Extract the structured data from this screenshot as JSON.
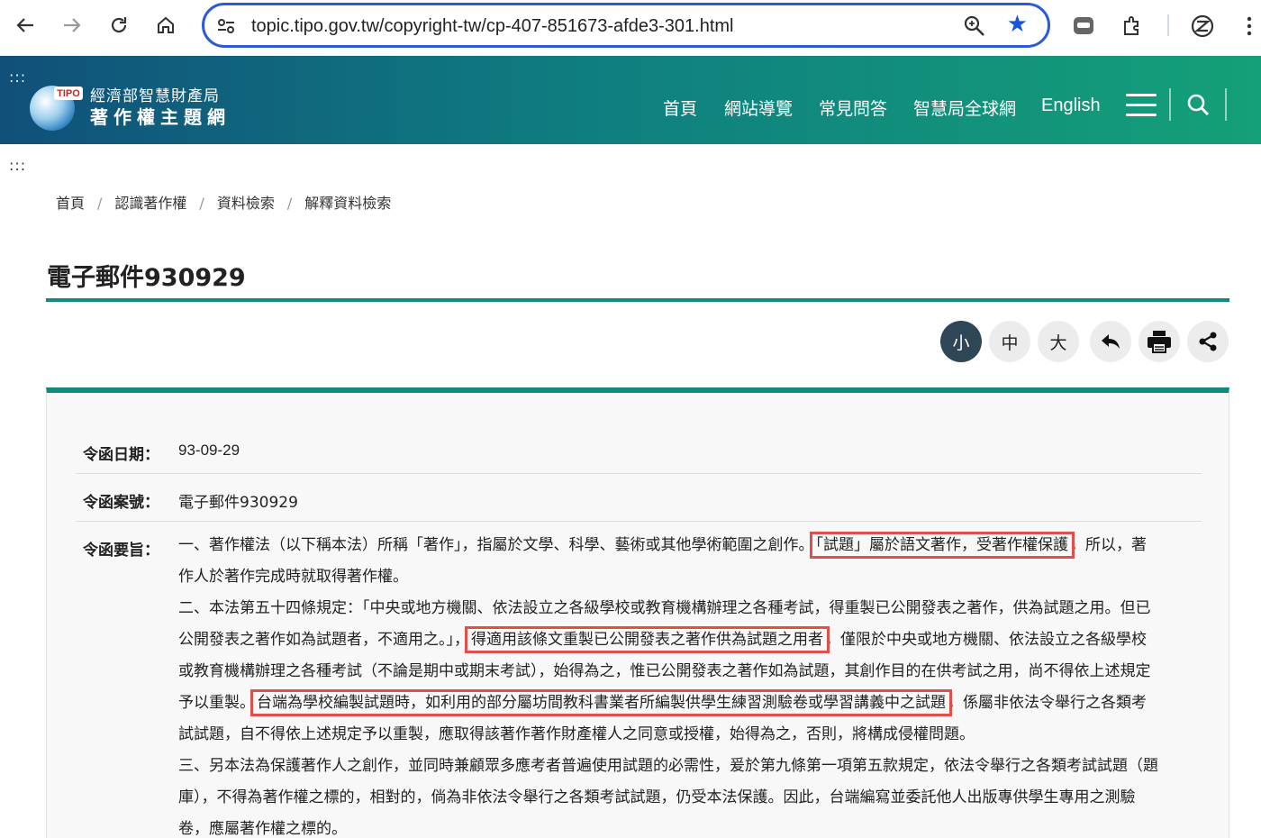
{
  "browser": {
    "url": "topic.tipo.gov.tw/copyright-tw/cp-407-851673-afde3-301.html"
  },
  "header": {
    "skip_marker": ":::",
    "logo_badge": "TIPO",
    "logo_line1": "經濟部智慧財產局",
    "logo_line2": "著作權主題網",
    "nav": [
      "首頁",
      "網站導覽",
      "常見問答",
      "智慧局全球網",
      "English"
    ]
  },
  "skip_marker_2": ":::",
  "breadcrumb": [
    "首頁",
    "認識著作權",
    "資料檢索",
    "解釋資料檢索"
  ],
  "breadcrumb_sep": "/",
  "page_title": "電子郵件930929",
  "tools": {
    "small": "小",
    "medium": "中",
    "large": "大"
  },
  "record": {
    "date_label": "令函日期：",
    "date_value": "93-09-29",
    "number_label": "令函案號：",
    "number_value": "電子郵件930929",
    "summary_label": "令函要旨：",
    "lines": [
      {
        "segments": [
          {
            "text": "一、著作權法（以下稱本法）所稱「著作」，指屬於文學、科學、藝術或其他學術範圍之創作。",
            "hl": false
          },
          {
            "text": "「試題」屬於語文著作，受著作權保護",
            "hl": true
          },
          {
            "text": "，所以，著",
            "hl": false
          }
        ]
      },
      {
        "segments": [
          {
            "text": "作人於著作完成時就取得著作權。",
            "hl": false
          }
        ]
      },
      {
        "segments": [
          {
            "text": "二、本法第五十四條規定：「中央或地方機關、依法設立之各級學校或教育機構辦理之各種考試，得重製已公開發表之著作，供為試題之用。但已",
            "hl": false
          }
        ]
      },
      {
        "segments": [
          {
            "text": "公開發表之著作如為試題者，不適用之。」，",
            "hl": false
          },
          {
            "text": "得適用該條文重製已公開發表之著作供為試題之用者",
            "hl": true
          },
          {
            "text": "，僅限於中央或地方機關、依法設立之各級學校",
            "hl": false
          }
        ]
      },
      {
        "segments": [
          {
            "text": "或教育機構辦理之各種考試（不論是期中或期末考試），始得為之，惟已公開發表之著作如為試題，其創作目的在供考試之用，尚不得依上述規定",
            "hl": false
          }
        ]
      },
      {
        "segments": [
          {
            "text": "予以重製。",
            "hl": false
          },
          {
            "text": "台端為學校編製試題時，如利用的部分屬坊間教科書業者所編製供學生練習測驗卷或學習講義中之試題",
            "hl": true
          },
          {
            "text": "，係屬非依法令舉行之各類考",
            "hl": false
          }
        ]
      },
      {
        "segments": [
          {
            "text": "試試題，自不得依上述規定予以重製，應取得該著作著作財產權人之同意或授權，始得為之，否則，將構成侵權問題。",
            "hl": false
          }
        ]
      },
      {
        "segments": [
          {
            "text": "三、另本法為保護著作人之創作，並同時兼顧眾多應考者普遍使用試題的必需性，爰於第九條第一項第五款規定，依法令舉行之各類考試試題（題",
            "hl": false
          }
        ]
      },
      {
        "segments": [
          {
            "text": "庫），不得為著作權之標的，相對的，倘為非依法令舉行之各類考試試題，仍受本法保護。因此，台端編寫並委託他人出版專供學生專用之測驗",
            "hl": false
          }
        ]
      },
      {
        "segments": [
          {
            "text": "卷，應屬著作權之標的。",
            "hl": false
          }
        ]
      }
    ]
  },
  "colors": {
    "accent": "#138a7e",
    "highlight_box": "#e0504a",
    "active_tool": "#2e4656"
  }
}
